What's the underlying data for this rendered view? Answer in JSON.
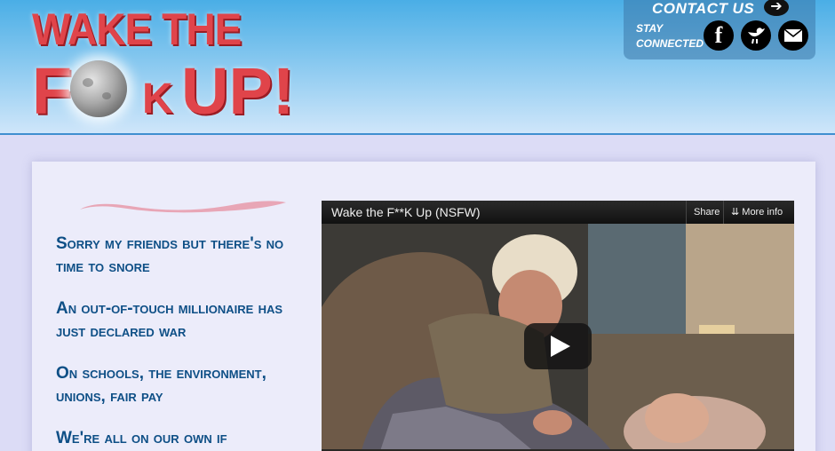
{
  "logo": {
    "line1": "WAKE THE",
    "f": "F",
    "k": "K",
    "up": "UP!"
  },
  "contact": {
    "label": "CONTACT US",
    "arrow": "➔",
    "stay_connected": "STAY CONNECTED",
    "social": [
      {
        "name": "facebook-icon",
        "glyph": "f"
      },
      {
        "name": "twitter-bird-icon",
        "glyph": ""
      },
      {
        "name": "email-icon",
        "glyph": ""
      }
    ]
  },
  "lyrics": [
    "Sorry my friends but there's no time to snore",
    "An out-of-touch millionaire has just declared war",
    "On schools, the environment, unions, fair pay",
    "We're all on our own if"
  ],
  "video": {
    "title": "Wake the F**K Up (NSFW)",
    "share_label": "Share",
    "more_label": "More info"
  },
  "colors": {
    "header_top": "#4aaee6",
    "logo_red": "#e0444a",
    "lyric_blue": "#0e4f86",
    "page_bg": "#dcdcf6"
  }
}
